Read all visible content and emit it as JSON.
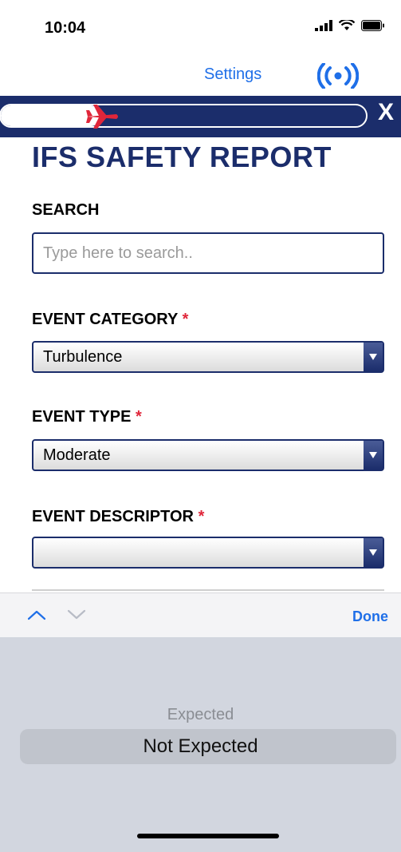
{
  "status_bar": {
    "time": "10:04"
  },
  "nav": {
    "settings_label": "Settings"
  },
  "header": {
    "close_label": "X"
  },
  "page": {
    "title": "IFS SAFETY REPORT"
  },
  "form": {
    "search": {
      "label": "SEARCH",
      "placeholder": "Type here to search..",
      "value": ""
    },
    "event_category": {
      "label": "EVENT CATEGORY",
      "required_mark": "*",
      "selected": "Turbulence"
    },
    "event_type": {
      "label": "EVENT TYPE",
      "required_mark": "*",
      "selected": "Moderate"
    },
    "event_descriptor": {
      "label": "EVENT DESCRIPTOR",
      "required_mark": "*",
      "selected": ""
    }
  },
  "keyboard_toolbar": {
    "done_label": "Done"
  },
  "picker": {
    "options": [
      "Expected",
      "Not Expected"
    ],
    "selected": "Not Expected"
  },
  "colors": {
    "brand_navy": "#1b2d6b",
    "accent_blue": "#1f6fe8",
    "required_red": "#e0263a",
    "plane_red": "#e0263a"
  },
  "icons": {
    "wireless": "broadcast-icon",
    "plane": "airplane-icon",
    "dropdown": "triangle-down-icon",
    "prev": "chevron-up-icon",
    "next": "chevron-down-icon"
  }
}
